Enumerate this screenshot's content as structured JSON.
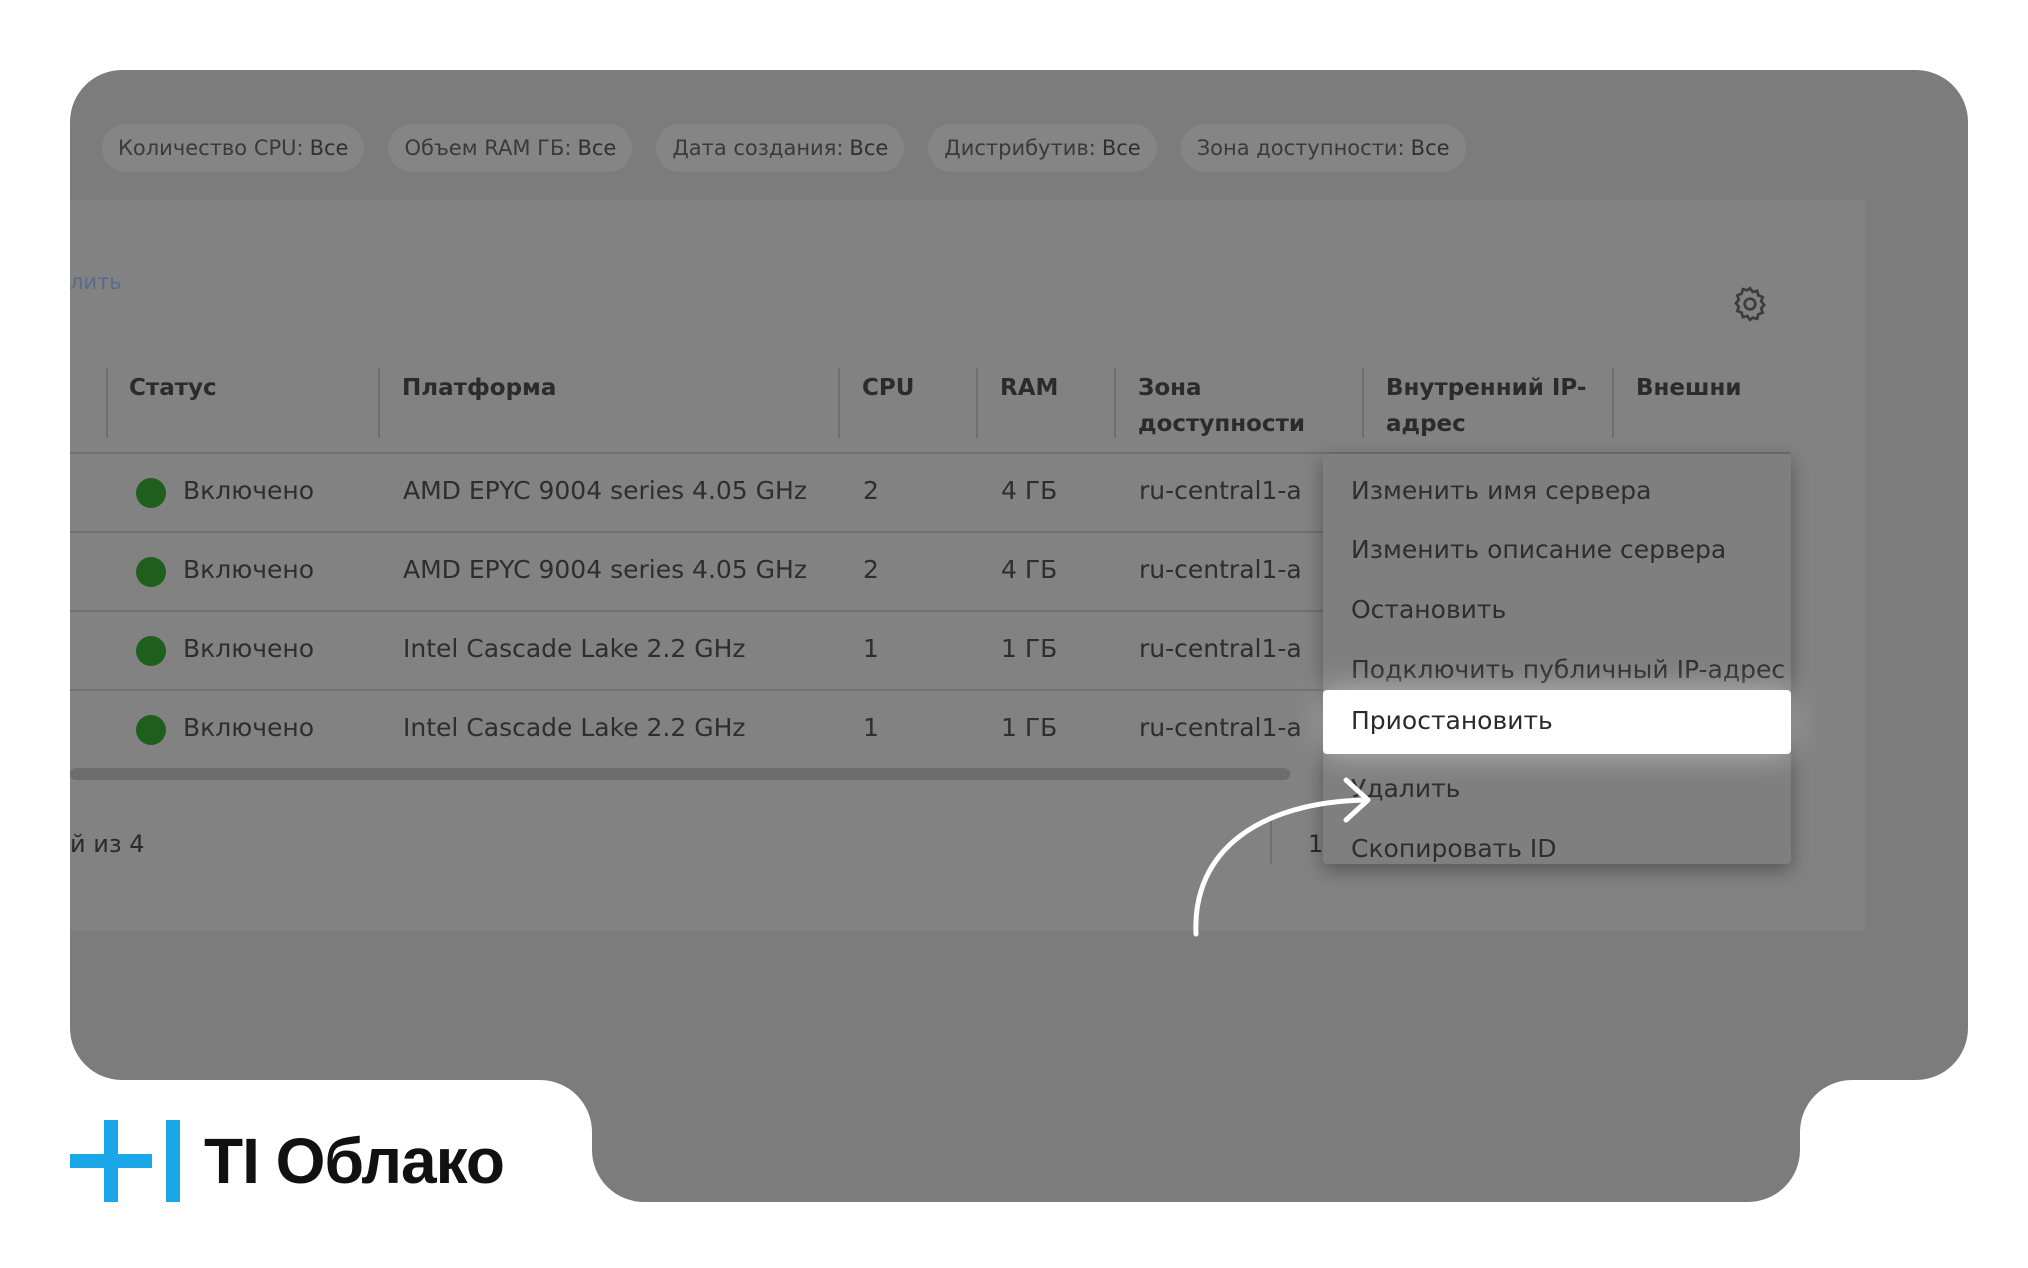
{
  "filters": [
    {
      "label": "Количество CPU:",
      "value": "Все"
    },
    {
      "label": "Объем RAM ГБ:",
      "value": "Все"
    },
    {
      "label": "Дата создания:",
      "value": "Все"
    },
    {
      "label": "Дистрибутив:",
      "value": "Все"
    },
    {
      "label": "Зона доступности:",
      "value": "Все"
    }
  ],
  "toolbar": {
    "cut_link": "лить"
  },
  "table": {
    "headers": {
      "status": "Статус",
      "platform": "Платформа",
      "cpu": "CPU",
      "ram": "RAM",
      "zone_line1": "Зона",
      "zone_line2": "доступности",
      "internal_ip_line1": "Внутренний IP-",
      "internal_ip_line2": "адрес",
      "external": "Внешни"
    },
    "rows": [
      {
        "status": "Включено",
        "platform": "AMD EPYC 9004 series 4.05 GHz",
        "cpu": "2",
        "ram": "4 ГБ",
        "zone": "ru-central1-a"
      },
      {
        "status": "Включено",
        "platform": "AMD EPYC 9004 series 4.05 GHz",
        "cpu": "2",
        "ram": "4 ГБ",
        "zone": "ru-central1-a"
      },
      {
        "status": "Включено",
        "platform": "Intel Cascade Lake 2.2 GHz",
        "cpu": "1",
        "ram": "1 ГБ",
        "zone": "ru-central1-a"
      },
      {
        "status": "Включено",
        "platform": "Intel Cascade Lake 2.2 GHz",
        "cpu": "1",
        "ram": "1 ГБ",
        "zone": "ru-central1-a"
      }
    ],
    "status_color": "#1e5f1e"
  },
  "pagination": {
    "summary": "й из 4",
    "page": "1"
  },
  "context_menu": {
    "items": [
      "Изменить имя сервера",
      "Изменить описание сервера",
      "Остановить",
      "Подключить публичный IP-адрес",
      "Приостановить",
      "Удалить",
      "Скопировать ID"
    ],
    "highlighted_index": 4
  },
  "brand": {
    "name": "TI Облако",
    "accent": "#1aa7e8"
  }
}
